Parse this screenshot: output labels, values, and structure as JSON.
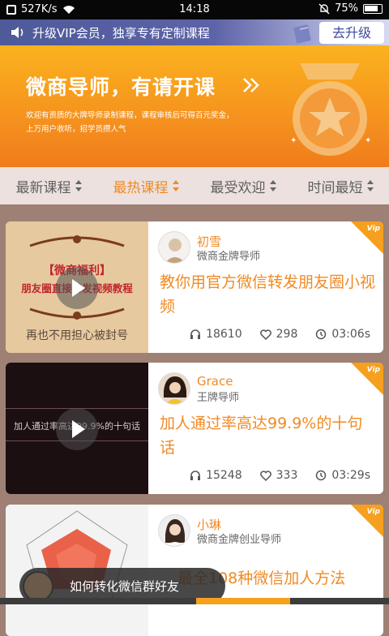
{
  "status": {
    "speed": "527K/s",
    "time": "14:18",
    "battery": "75%"
  },
  "vip_bar": {
    "text": "升级VIP会员，独享专有定制课程",
    "button": "去升级"
  },
  "banner": {
    "title": "微商导师，有请开课",
    "desc_line1": "欢迎有资质的大牌导师录制课程，课程审核后可得百元奖金，",
    "desc_line2": "上万用户收听，招学员攒人气"
  },
  "tabs": [
    {
      "label": "最新课程"
    },
    {
      "label": "最热课程"
    },
    {
      "label": "最受欢迎"
    },
    {
      "label": "时间最短"
    }
  ],
  "courses": [
    {
      "teacher": "初雪",
      "role": "微商金牌导师",
      "title": "教你用官方微信转发朋友圈小视频",
      "listens": "18610",
      "likes": "298",
      "duration": "03:06s",
      "thumb_lines": [
        "【微商福利】",
        "朋友圈直接转发视频教程",
        "再也不用担心被封号"
      ]
    },
    {
      "teacher": "Grace",
      "role": "王牌导师",
      "title": "加人通过率高达99.9%的十句话",
      "listens": "15248",
      "likes": "333",
      "duration": "03:29s",
      "thumb_lines": [
        "加人通过率高达99.9%的十句话"
      ]
    },
    {
      "teacher": "小琳",
      "role": "微商金牌创业导师",
      "title": "最全108种微信加人方法",
      "listens": "",
      "likes": "",
      "duration": ""
    }
  ],
  "mini_player": {
    "title": "如何转化微信群好友"
  },
  "colors": {
    "accent": "#f08a24",
    "vip_bar": "#5d63a8",
    "banner": "#f5921e"
  }
}
